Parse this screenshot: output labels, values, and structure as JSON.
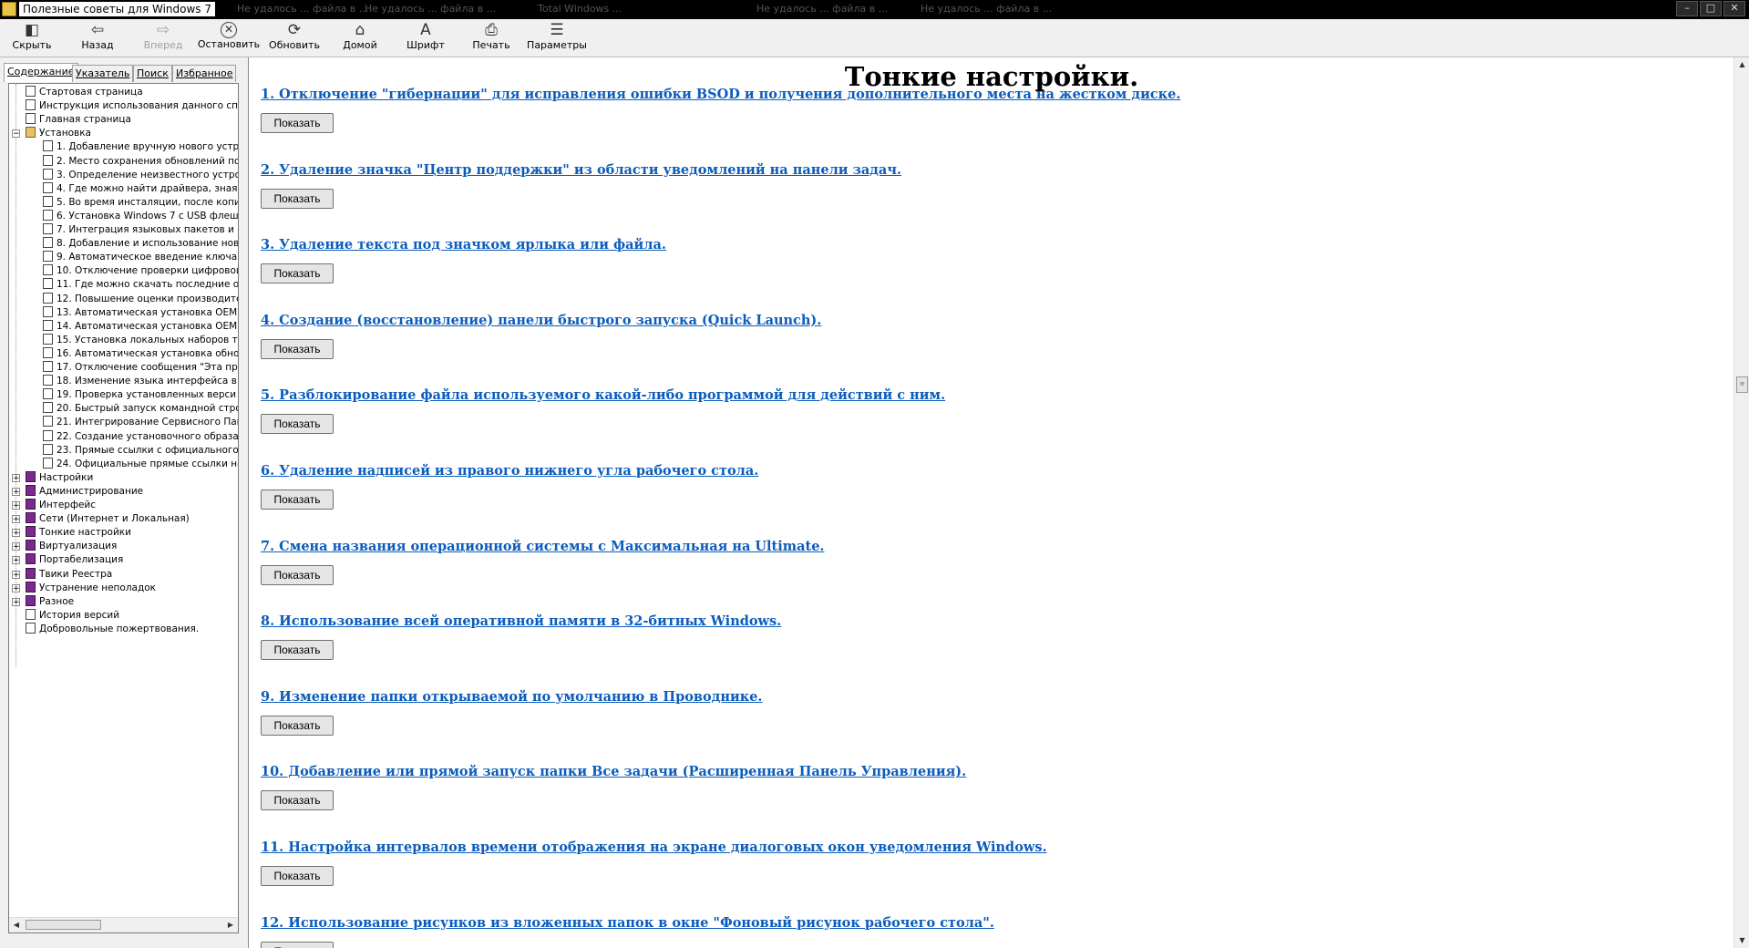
{
  "window": {
    "title": "Полезные советы для Windows 7",
    "background_tabs": [
      "Не удалось ... файла в ...",
      "Не удалось ... файла в ...",
      "Total Windows ...",
      "Не удалось ... файла в ...",
      "Не удалось ... файла в ..."
    ],
    "controls": {
      "minimize": "–",
      "maximize": "□",
      "close": "✕"
    }
  },
  "toolbar": [
    {
      "label": "Скрыть",
      "icon": "hide-pane-icon",
      "glyph": "◧",
      "enabled": true
    },
    {
      "label": "Назад",
      "icon": "back-arrow-icon",
      "glyph": "⇦",
      "enabled": true
    },
    {
      "label": "Вперед",
      "icon": "forward-arrow-icon",
      "glyph": "⇨",
      "enabled": false
    },
    {
      "label": "Остановить",
      "icon": "stop-icon",
      "glyph": "✕",
      "enabled": true
    },
    {
      "label": "Обновить",
      "icon": "refresh-icon",
      "glyph": "⟳",
      "enabled": true
    },
    {
      "label": "Домой",
      "icon": "home-icon",
      "glyph": "⌂",
      "enabled": true
    },
    {
      "label": "Шрифт",
      "icon": "font-icon",
      "glyph": "A",
      "enabled": true
    },
    {
      "label": "Печать",
      "icon": "print-icon",
      "glyph": "⎙",
      "enabled": true
    },
    {
      "label": "Параметры",
      "icon": "options-icon",
      "glyph": "☰",
      "enabled": true
    }
  ],
  "nav_tabs": [
    "Содержание",
    "Указатель",
    "Поиск",
    "Избранное"
  ],
  "active_nav_tab": 0,
  "tree": [
    {
      "label": "Стартовая страница",
      "type": "page",
      "level": 0
    },
    {
      "label": "Инструкция использования данного спр",
      "type": "page",
      "level": 0
    },
    {
      "label": "Главная страница",
      "type": "page",
      "level": 0
    },
    {
      "label": "Установка",
      "type": "book-open",
      "level": 0,
      "expander": "−"
    },
    {
      "label": "1. Добавление вручную нового устр",
      "type": "page",
      "level": 1
    },
    {
      "label": "2. Место сохранения обновлений по",
      "type": "page",
      "level": 1
    },
    {
      "label": "3. Определение неизвестного устро",
      "type": "page",
      "level": 1
    },
    {
      "label": "4. Где можно найти драйвера, зная \\",
      "type": "page",
      "level": 1
    },
    {
      "label": "5. Во время инсталяции, после копи",
      "type": "page",
      "level": 1
    },
    {
      "label": "6. Установка Windows 7 с USB флеш",
      "type": "page",
      "level": 1
    },
    {
      "label": "7. Интеграция языковых пакетов и с",
      "type": "page",
      "level": 1
    },
    {
      "label": "8. Добавление и использование нов",
      "type": "page",
      "level": 1
    },
    {
      "label": "9. Автоматическое введение ключа",
      "type": "page",
      "level": 1
    },
    {
      "label": "10. Отключение проверки цифровой",
      "type": "page",
      "level": 1
    },
    {
      "label": "11. Где можно скачать последние об",
      "type": "page",
      "level": 1
    },
    {
      "label": "12. Повышение оценки производите",
      "type": "page",
      "level": 1
    },
    {
      "label": "13. Автоматическая установка OEM",
      "type": "page",
      "level": 1
    },
    {
      "label": "14. Автоматическая установка OEM",
      "type": "page",
      "level": 1
    },
    {
      "label": "15. Установка локальных наборов т",
      "type": "page",
      "level": 1
    },
    {
      "label": "16. Автоматическая установка обно",
      "type": "page",
      "level": 1
    },
    {
      "label": "17. Отключение сообщения \"Эта про",
      "type": "page",
      "level": 1
    },
    {
      "label": "18. Изменение языка интерфейса в",
      "type": "page",
      "level": 1
    },
    {
      "label": "19. Проверка установленных верси",
      "type": "page",
      "level": 1
    },
    {
      "label": "20. Быстрый запуск командной стро",
      "type": "page",
      "level": 1
    },
    {
      "label": "21. Интегрирование Сервисного Пак",
      "type": "page",
      "level": 1
    },
    {
      "label": "22. Создание установочного образа",
      "type": "page",
      "level": 1
    },
    {
      "label": "23. Прямые ссылки с официального",
      "type": "page",
      "level": 1
    },
    {
      "label": "24. Официальные прямые ссылки на",
      "type": "page",
      "level": 1
    },
    {
      "label": "Настройки",
      "type": "book",
      "level": 0,
      "expander": "+"
    },
    {
      "label": "Администрирование",
      "type": "book",
      "level": 0,
      "expander": "+"
    },
    {
      "label": "Интерфейс",
      "type": "book",
      "level": 0,
      "expander": "+"
    },
    {
      "label": "Сети (Интернет и Локальная)",
      "type": "book",
      "level": 0,
      "expander": "+"
    },
    {
      "label": "Тонкие настройки",
      "type": "book",
      "level": 0,
      "expander": "+"
    },
    {
      "label": "Виртуализация",
      "type": "book",
      "level": 0,
      "expander": "+"
    },
    {
      "label": "Портабелизация",
      "type": "book",
      "level": 0,
      "expander": "+"
    },
    {
      "label": "Твики Реестра",
      "type": "book",
      "level": 0,
      "expander": "+"
    },
    {
      "label": "Устранение неполадок",
      "type": "book",
      "level": 0,
      "expander": "+"
    },
    {
      "label": "Разное",
      "type": "book",
      "level": 0,
      "expander": "+"
    },
    {
      "label": "История версий",
      "type": "page",
      "level": 0
    },
    {
      "label": "Добровольные пожертвования.",
      "type": "page",
      "level": 0
    }
  ],
  "content": {
    "title": "Тонкие настройки.",
    "show_button_label": "Показать",
    "topics": [
      "1. Отключение \"гибернации\" для исправления ошибки BSOD и получения дополнительного места на жестком диске.",
      "2. Удаление значка \"Центр поддержки\" из области уведомлений на панели задач.",
      "3. Удаление текста под значком ярлыка или файла.",
      "4. Создание (восстановление) панели быстрого запуска (Quick Launch).",
      "5. Разблокирование файла используемого какой-либо программой для действий с ним.",
      "6. Удаление надписей из правого нижнего угла рабочего стола.",
      "7. Смена названия операционной системы с Максимальная на Ultimate.",
      "8. Использование всей оперативной памяти в 32-битных Windows.",
      "9. Изменение папки открываемой по умолчанию в Проводнике.",
      "10. Добавление или прямой запуск папки Все задачи (Расширенная Панель Управления).",
      "11. Настройка интервалов времени отображения на экране диалоговых окон уведомления Windows.",
      "12. Использование рисунков из вложенных папок в окне \"Фоновый рисунок рабочего стола\"."
    ]
  }
}
